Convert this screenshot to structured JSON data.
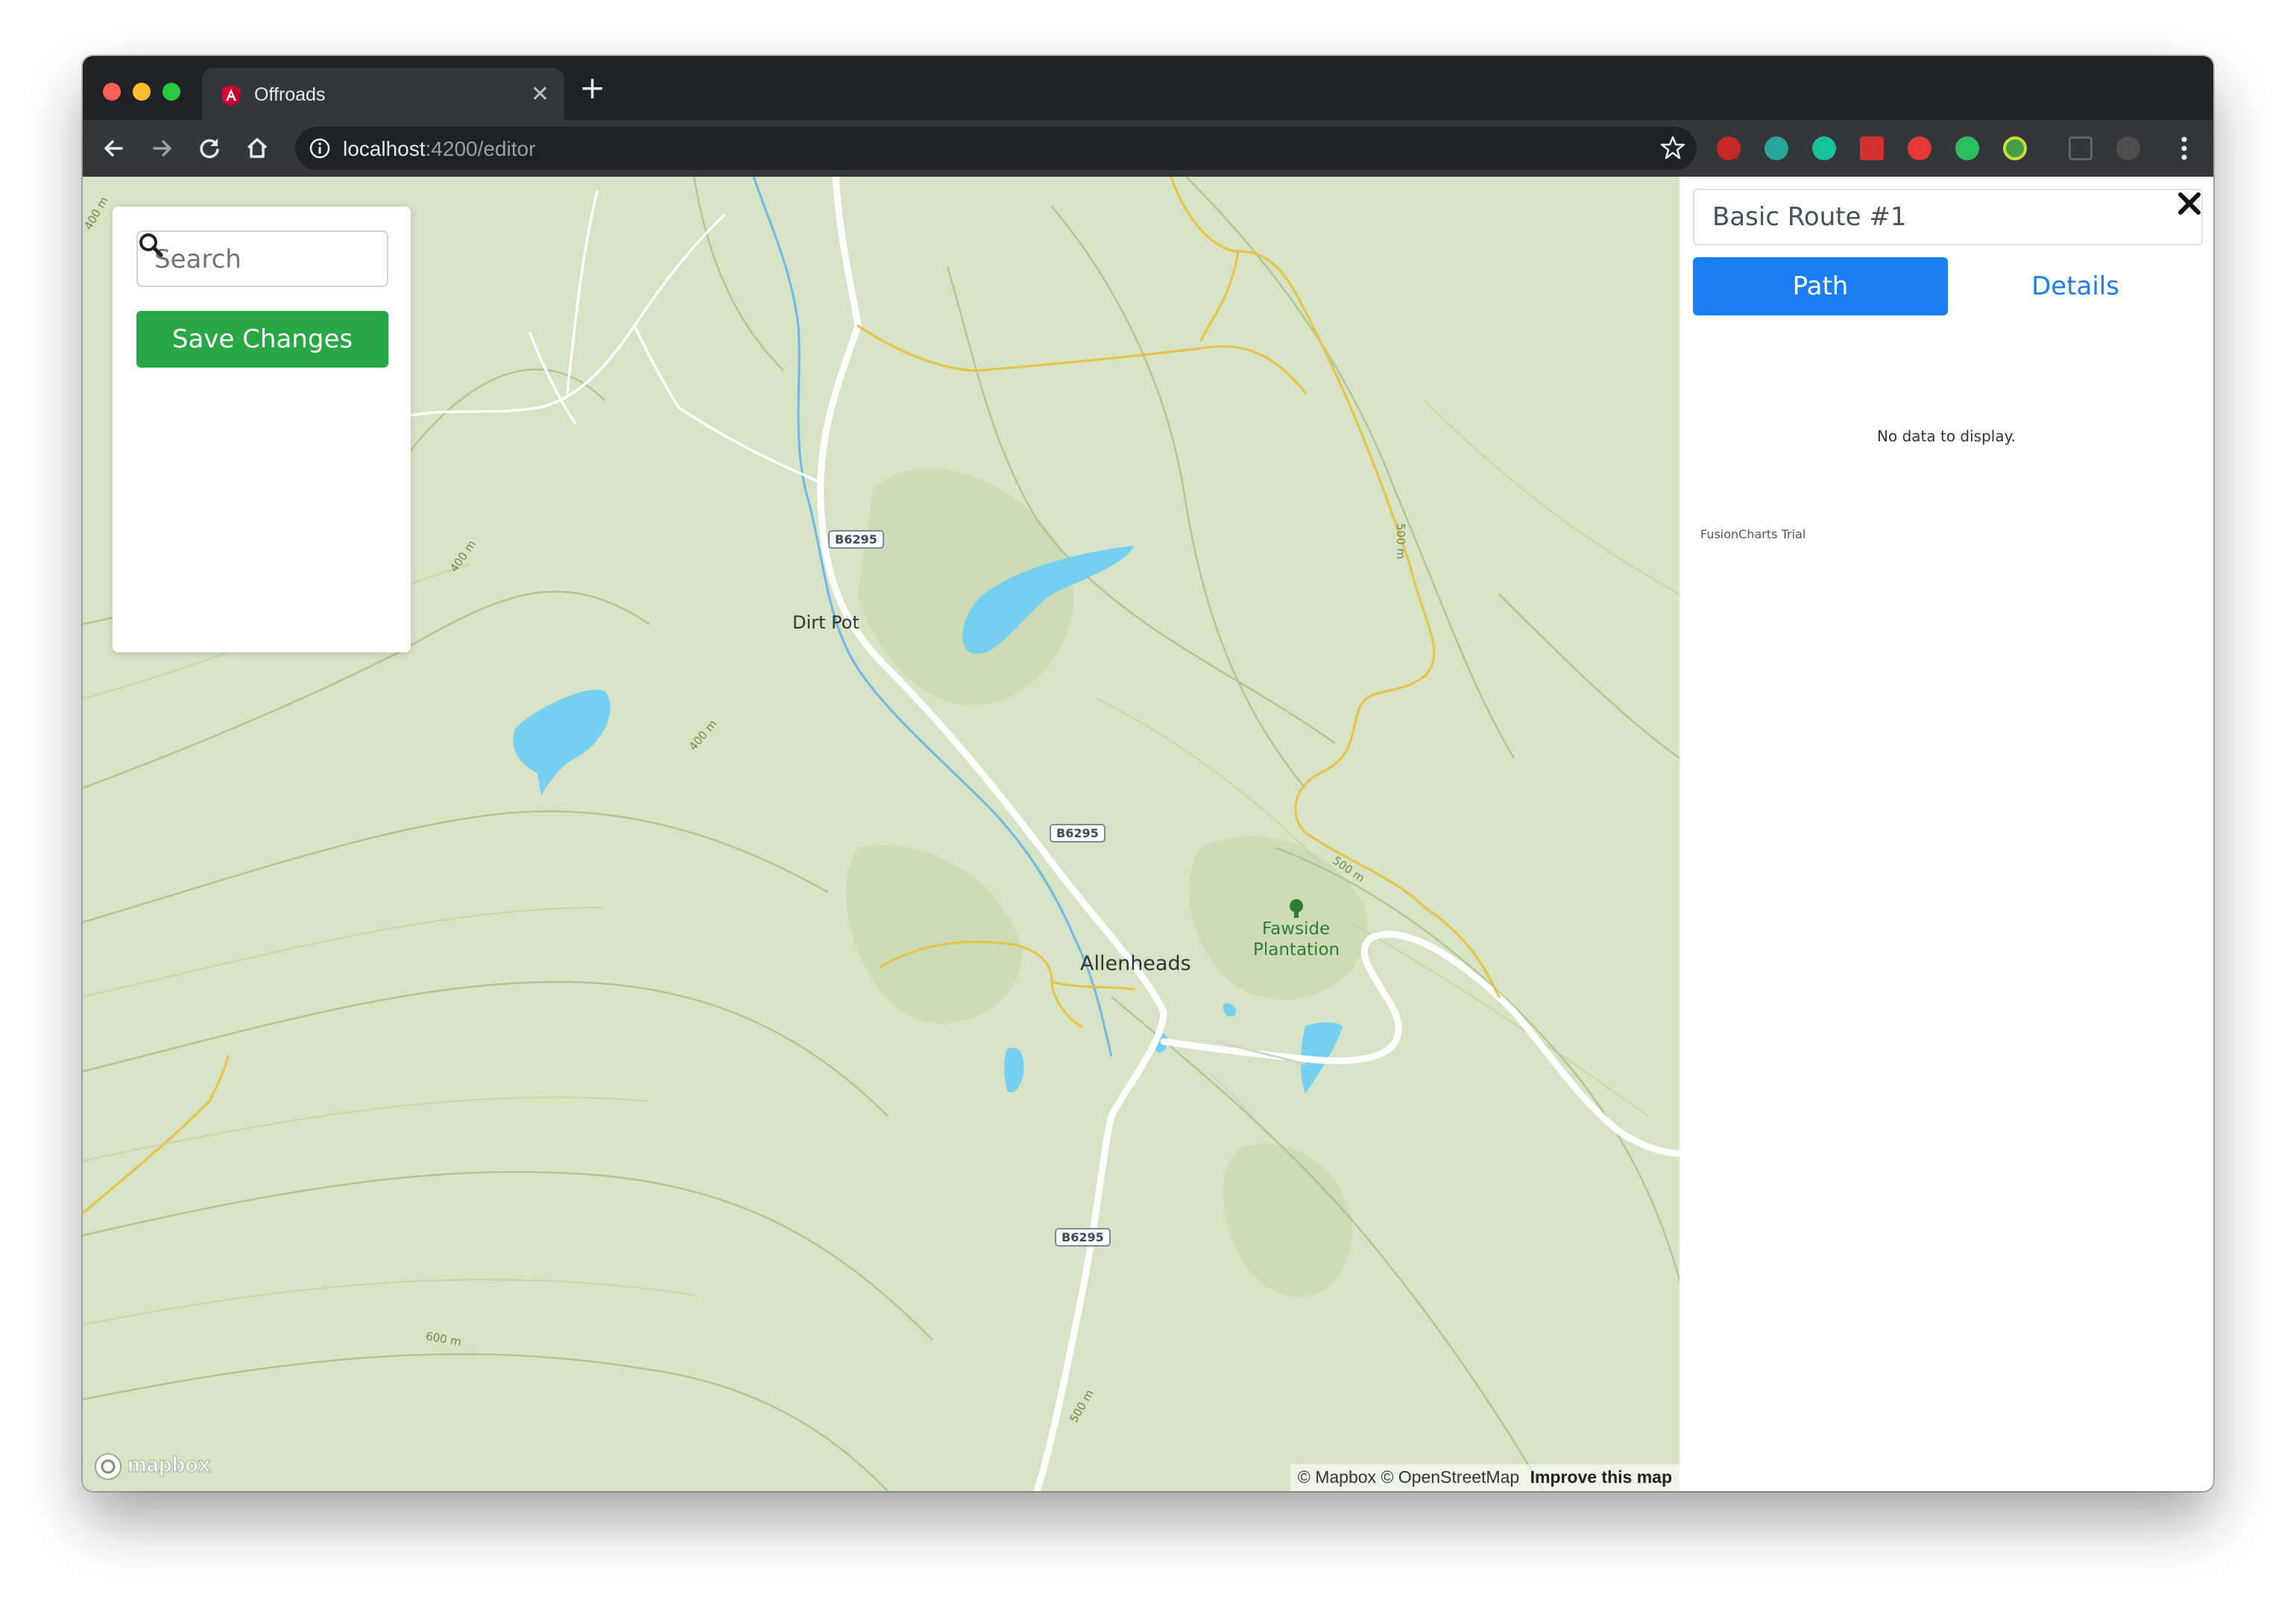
{
  "browser": {
    "tab_title": "Offroads",
    "url_host": "localhost",
    "url_path": ":4200/editor"
  },
  "map": {
    "place_labels": [
      "Dirt Pot",
      "Allenheads",
      "Fawside",
      "Plantation"
    ],
    "road_shields": [
      "B6295",
      "B6295",
      "B6295"
    ],
    "contour_labels": [
      "400 m",
      "400 m",
      "400 m",
      "500 m",
      "500 m",
      "600 m",
      "500 m"
    ],
    "logo_text": "mapbox",
    "attribution": {
      "mapbox": "© Mapbox",
      "osm": "© OpenStreetMap",
      "improve": "Improve this map"
    },
    "colors": {
      "land": "#d6e3c4",
      "water": "#75cff0",
      "main_road": "#ffffff",
      "minor_road": "#e8c34a"
    }
  },
  "controls": {
    "search_placeholder": "Search",
    "save_label": "Save Changes"
  },
  "panel": {
    "route_name": "Basic Route #1",
    "tabs": [
      {
        "label": "Path",
        "active": true
      },
      {
        "label": "Details",
        "active": false
      }
    ],
    "chart_message": "No data to display.",
    "chart_watermark": "FusionCharts Trial"
  },
  "accent_colors": {
    "primary": "#1a7ef5",
    "success": "#28a745"
  }
}
